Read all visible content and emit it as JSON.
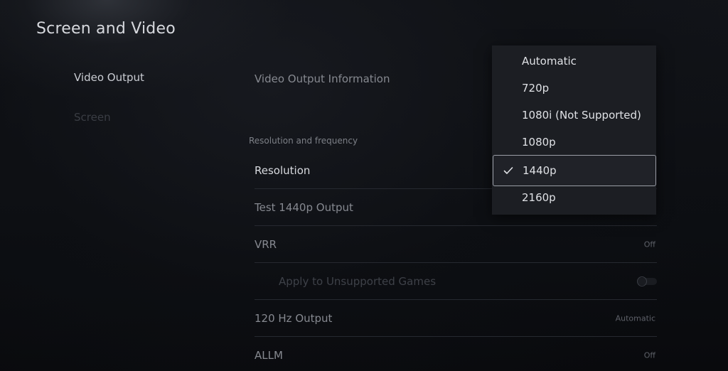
{
  "page": {
    "title": "Screen and Video"
  },
  "left_nav": {
    "items": [
      {
        "label": "Video Output",
        "state": "active"
      },
      {
        "label": "Screen",
        "state": "dim"
      }
    ]
  },
  "settings": {
    "video_output_info": {
      "label": "Video Output Information"
    },
    "section_header": "Resolution and frequency",
    "resolution": {
      "label": "Resolution"
    },
    "test_output": {
      "label": "Test 1440p Output"
    },
    "vrr": {
      "label": "VRR",
      "value": "Off"
    },
    "apply_unsupported": {
      "label": "Apply to Unsupported Games",
      "toggle": "off"
    },
    "hz_output": {
      "label": "120 Hz Output",
      "value": "Automatic"
    },
    "allm": {
      "label": "ALLM",
      "value": "Off"
    }
  },
  "resolution_dropdown": {
    "selected": "1440p",
    "options": [
      {
        "label": "Automatic"
      },
      {
        "label": "720p"
      },
      {
        "label": "1080i (Not Supported)"
      },
      {
        "label": "1080p"
      },
      {
        "label": "1440p"
      },
      {
        "label": "2160p"
      }
    ],
    "icons": {
      "check": "checkmark-icon"
    }
  },
  "colors": {
    "background": "#0b0d12",
    "dropdown_bg": "#1c1e23",
    "selected_border": "#9a9da6",
    "text_primary": "#d8dadf"
  }
}
